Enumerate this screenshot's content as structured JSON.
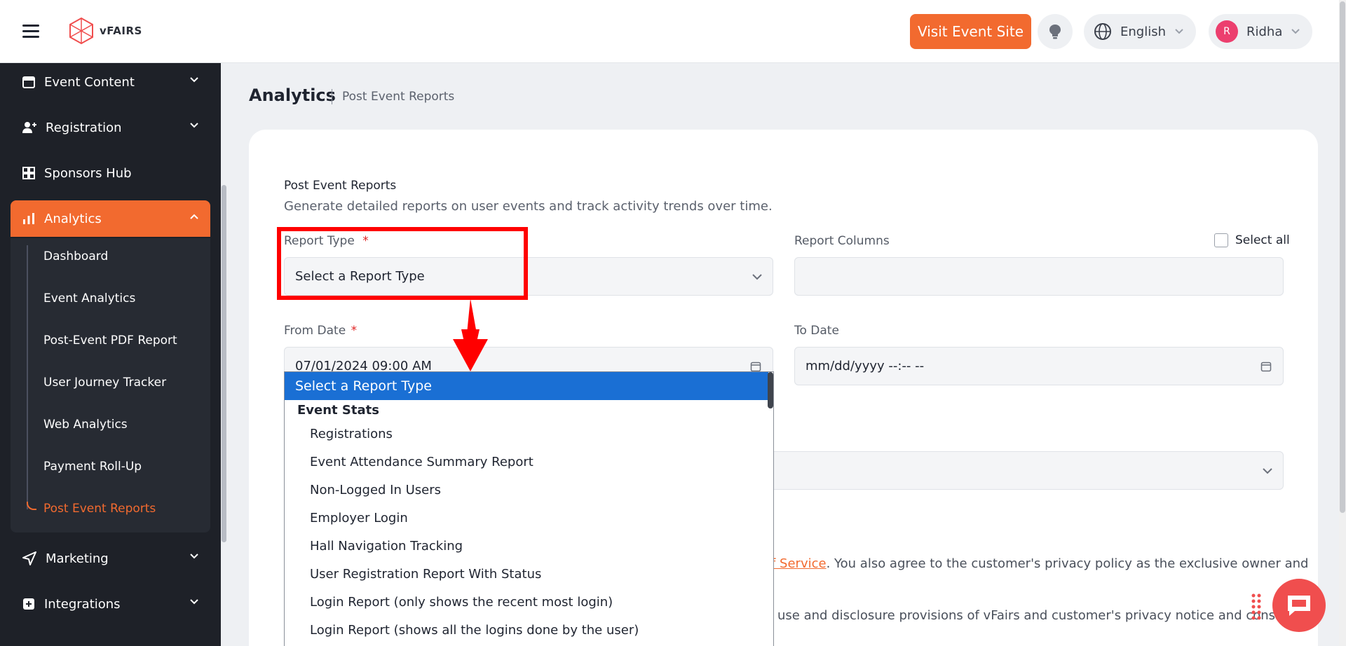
{
  "header": {
    "logo_text": "vFAIRS",
    "visit_label": "Visit Event Site",
    "language": "English",
    "user_initial": "R",
    "user_name": "Ridha"
  },
  "sidebar": {
    "items": [
      {
        "label": "Event Content",
        "icon": "calendar-icon"
      },
      {
        "label": "Registration",
        "icon": "user-plus-icon"
      },
      {
        "label": "Sponsors Hub",
        "icon": "grid-icon"
      },
      {
        "label": "Analytics",
        "icon": "bar-chart-icon"
      },
      {
        "label": "Marketing",
        "icon": "send-icon"
      },
      {
        "label": "Integrations",
        "icon": "plus-square-icon"
      }
    ],
    "sub_items": [
      "Dashboard",
      "Event Analytics",
      "Post-Event PDF Report",
      "User Journey Tracker",
      "Web Analytics",
      "Payment Roll-Up",
      "Post Event Reports"
    ]
  },
  "page": {
    "title": "Analytics",
    "breadcrumb": "Post Event Reports",
    "section_title": "Post Event Reports",
    "section_desc": "Generate detailed reports on user events and track activity trends over time."
  },
  "form": {
    "report_type_label": "Report Type",
    "report_type_value": "Select a Report Type",
    "report_columns_label": "Report Columns",
    "select_all_label": "Select all",
    "from_date_label": "From Date",
    "from_date_value": "07/01/2024 09:00 AM",
    "to_date_label": "To Date",
    "to_date_placeholder": "mm/dd/yyyy --:-- --",
    "required_mark": "*"
  },
  "dropdown": {
    "selected": "Select a Report Type",
    "group": "Event Stats",
    "options": [
      "Registrations",
      "Event Attendance Summary Report",
      "Non-Logged In Users",
      "Employer Login",
      "Hall Navigation Tracking",
      "User Registration Report With Status",
      "Login Report (only shows the recent most login)",
      "Login Report (shows all the logins done by the user)"
    ]
  },
  "footer": {
    "terms_link": "f Service",
    "terms_text": ". You also agree to the customer's privacy policy as the exclusive owner and",
    "privacy_text": "use and disclosure provisions of vFairs and customer's privacy notice and consistent"
  },
  "colors": {
    "accent": "#f26a2f",
    "sidebar_bg": "#1e2128",
    "highlight": "#ff0000",
    "dropdown_selected": "#1a6fd4"
  }
}
